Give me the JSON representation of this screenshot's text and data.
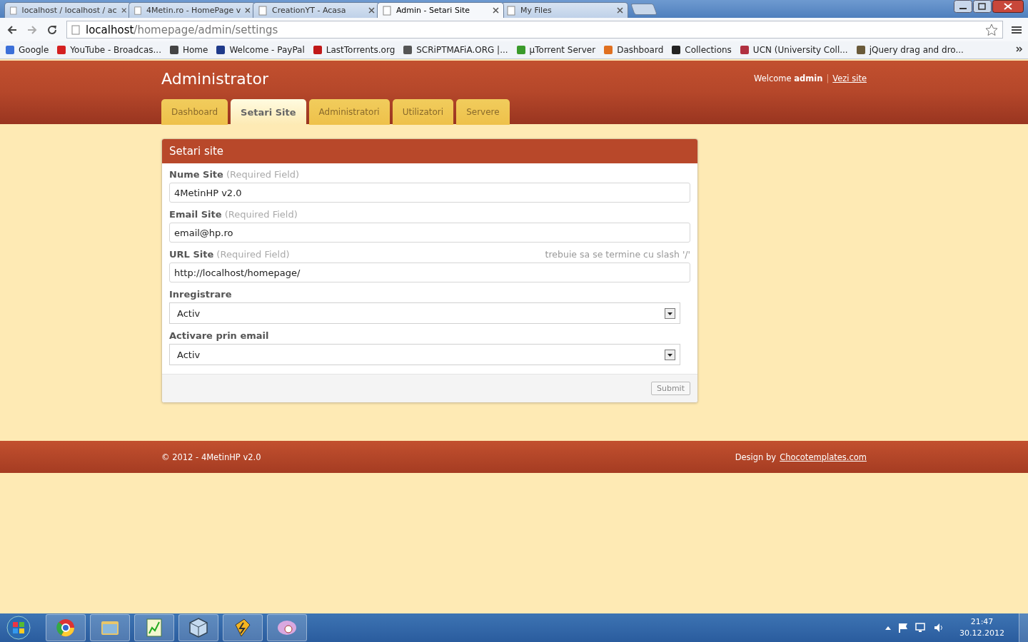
{
  "browser": {
    "tabs": [
      {
        "title": "localhost / localhost / ac",
        "selected": false
      },
      {
        "title": "4Metin.ro - HomePage v",
        "selected": false
      },
      {
        "title": "CreationYT - Acasa",
        "selected": false
      },
      {
        "title": "Admin - Setari Site",
        "selected": true
      },
      {
        "title": "My Files",
        "selected": false
      }
    ],
    "address": {
      "host": "localhost",
      "path": "/homepage/admin/settings"
    },
    "bookmarks": [
      {
        "label": "Google",
        "color": "#3b6fd8"
      },
      {
        "label": "YouTube - Broadcas...",
        "color": "#d42020"
      },
      {
        "label": "Home",
        "color": "#444444"
      },
      {
        "label": "Welcome - PayPal",
        "color": "#1f3a8a"
      },
      {
        "label": "LastTorrents.org",
        "color": "#c01818"
      },
      {
        "label": "SCRiPTMAFiA.ORG |...",
        "color": "#555555"
      },
      {
        "label": "µTorrent Server",
        "color": "#3a9a2a"
      },
      {
        "label": "Dashboard",
        "color": "#e07020"
      },
      {
        "label": "Collections",
        "color": "#222222"
      },
      {
        "label": "UCN (University Coll...",
        "color": "#b03040"
      },
      {
        "label": "jQuery drag and dro...",
        "color": "#6a5a3a"
      }
    ]
  },
  "site": {
    "title": "Administrator",
    "welcome": "Welcome",
    "user": "admin",
    "separator": "|",
    "link": "Vezi site"
  },
  "nav_tabs": [
    {
      "label": "Dashboard",
      "selected": false
    },
    {
      "label": "Setari Site",
      "selected": true
    },
    {
      "label": "Administratori",
      "selected": false
    },
    {
      "label": "Utilizatori",
      "selected": false
    },
    {
      "label": "Servere",
      "selected": false
    }
  ],
  "panel": {
    "title": "Setari site",
    "fields": [
      {
        "kind": "text",
        "label": "Nume Site",
        "hint": "(Required Field)",
        "value": "4MetinHP v2.0"
      },
      {
        "kind": "text",
        "label": "Email Site",
        "hint": "(Required Field)",
        "value": "email@hp.ro"
      },
      {
        "kind": "text",
        "label": "URL Site",
        "hint": "(Required Field)",
        "note": "trebuie sa se termine cu slash '/'",
        "value": "http://localhost/homepage/"
      },
      {
        "kind": "select",
        "label": "Inregistrare",
        "value": "Activ"
      },
      {
        "kind": "select",
        "label": "Activare prin email",
        "value": "Activ"
      }
    ],
    "submit": "Submit"
  },
  "footer": {
    "copyright": "© 2012 - 4MetinHP v2.0",
    "design": "Design by",
    "design_link": "Chocotemplates.com"
  },
  "taskbar": {
    "time": "21:47",
    "date": "30.12.2012"
  }
}
